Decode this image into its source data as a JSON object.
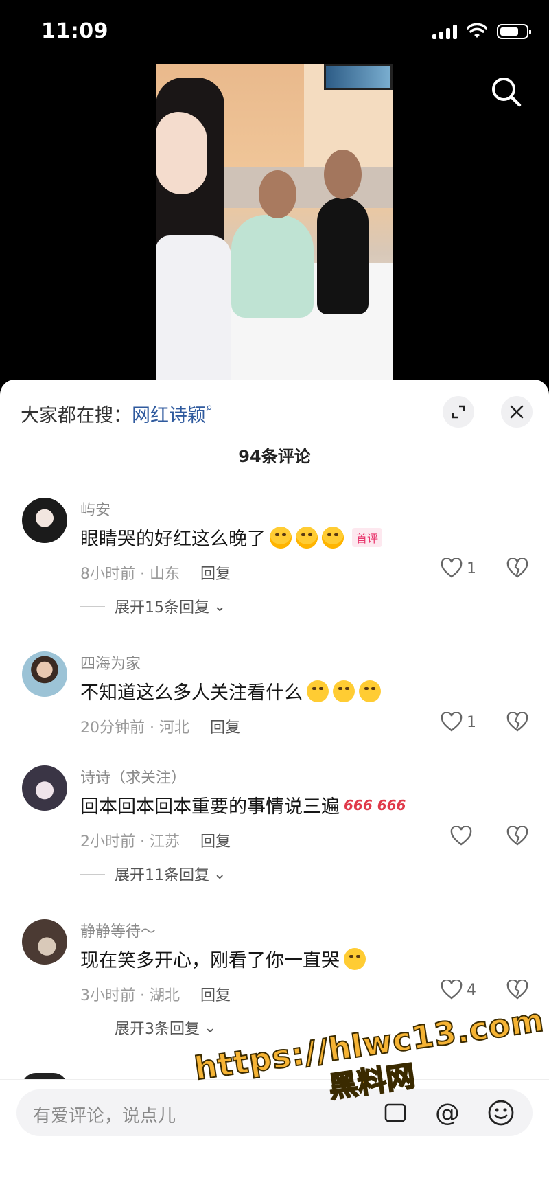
{
  "status": {
    "time": "11:09"
  },
  "sheet": {
    "hot_search_label": "大家都在搜：",
    "hot_search_keyword": "网红诗颖",
    "comment_count": "94条评论"
  },
  "comments": [
    {
      "username": "屿安",
      "text": "眼睛哭的好红这么晚了",
      "badge": "首评",
      "meta": "8小时前 · 山东",
      "reply": "回复",
      "likes": "1",
      "expand": "展开15条回复"
    },
    {
      "username": "四海为家",
      "text": "不知道这么多人关注看什么",
      "meta": "20分钟前 · 河北",
      "reply": "回复",
      "likes": "1"
    },
    {
      "username": "诗诗（求关注）",
      "text": "回本回本回本重要的事情说三遍",
      "emoji_text": "666 666",
      "meta": "2小时前 · 江苏",
      "reply": "回复",
      "likes": "",
      "expand": "展开11条回复"
    },
    {
      "username": "静静等待～",
      "text": "现在笑多开心，刚看了你一直哭",
      "meta": "3小时前 · 湖北",
      "reply": "回复",
      "likes": "4",
      "expand": "展开3条回复"
    }
  ],
  "input": {
    "placeholder": "有爱评论，说点儿"
  },
  "watermark": {
    "url": "https://hlwc13.com",
    "brand": "黑料网"
  },
  "colors": {
    "keyword": "#2f5a9e",
    "badge": "#e8366d",
    "watermark": "#f5b334"
  }
}
